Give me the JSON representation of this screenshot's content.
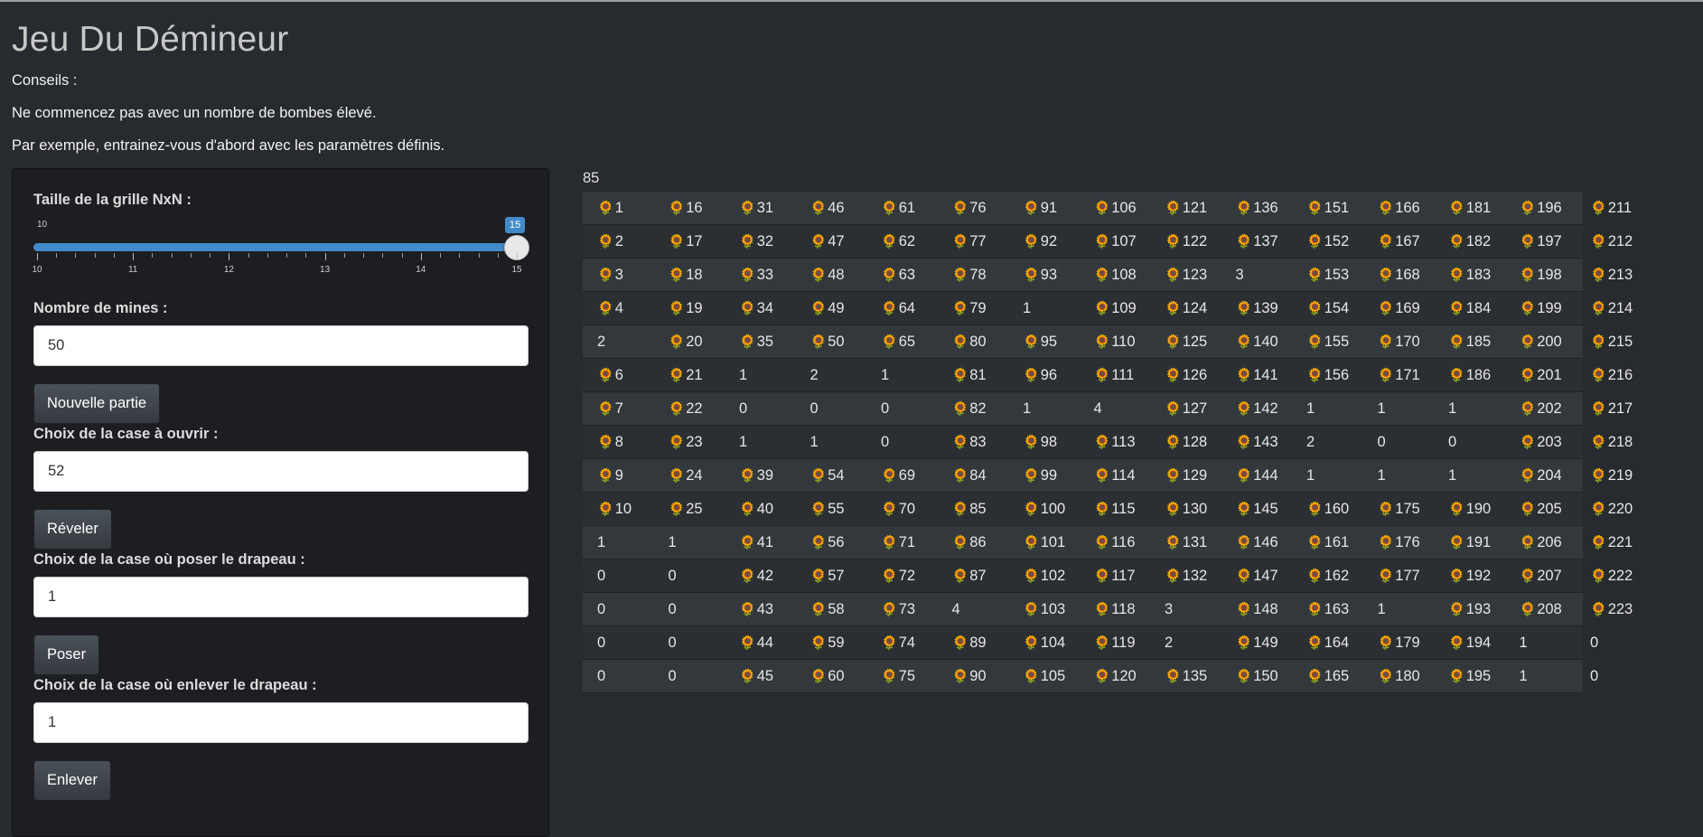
{
  "title": "Jeu Du Démineur",
  "tips": [
    "Conseils :",
    "Ne commencez pas avec un nombre de bombes élevé.",
    "Par exemple, entrainez-vous d'abord avec les paramètres définis."
  ],
  "controls": {
    "grid_size_label": "Taille de la grille NxN :",
    "slider": {
      "min": 10,
      "max": 15,
      "value": 15,
      "min_label": "10",
      "value_label": "15",
      "tick_labels": [
        "10",
        "11",
        "12",
        "13",
        "14",
        "15"
      ]
    },
    "mines_label": "Nombre de mines :",
    "mines_value": "50",
    "new_game_button": "Nouvelle partie",
    "open_label": "Choix de la case à ouvrir :",
    "open_value": "52",
    "reveal_button": "Réveler",
    "flag_label": "Choix de la case où poser le drapeau :",
    "flag_value": "1",
    "place_button": "Poser",
    "unflag_label": "Choix de la case où enlever le drapeau :",
    "unflag_value": "1",
    "remove_button": "Enlever"
  },
  "board": {
    "count": "85",
    "flag_icon": "sunflower-icon",
    "flag_glyph": "🌻",
    "rows": [
      [
        {
          "f": 1,
          "t": "1"
        },
        {
          "f": 1,
          "t": "16"
        },
        {
          "f": 1,
          "t": "31"
        },
        {
          "f": 1,
          "t": "46"
        },
        {
          "f": 1,
          "t": "61"
        },
        {
          "f": 1,
          "t": "76"
        },
        {
          "f": 1,
          "t": "91"
        },
        {
          "f": 1,
          "t": "106"
        },
        {
          "f": 1,
          "t": "121"
        },
        {
          "f": 1,
          "t": "136"
        },
        {
          "f": 1,
          "t": "151"
        },
        {
          "f": 1,
          "t": "166"
        },
        {
          "f": 1,
          "t": "181"
        },
        {
          "f": 1,
          "t": "196"
        },
        {
          "f": 1,
          "t": "211"
        }
      ],
      [
        {
          "f": 1,
          "t": "2"
        },
        {
          "f": 1,
          "t": "17"
        },
        {
          "f": 1,
          "t": "32"
        },
        {
          "f": 1,
          "t": "47"
        },
        {
          "f": 1,
          "t": "62"
        },
        {
          "f": 1,
          "t": "77"
        },
        {
          "f": 1,
          "t": "92"
        },
        {
          "f": 1,
          "t": "107"
        },
        {
          "f": 1,
          "t": "122"
        },
        {
          "f": 1,
          "t": "137"
        },
        {
          "f": 1,
          "t": "152"
        },
        {
          "f": 1,
          "t": "167"
        },
        {
          "f": 1,
          "t": "182"
        },
        {
          "f": 1,
          "t": "197"
        },
        {
          "f": 1,
          "t": "212"
        }
      ],
      [
        {
          "f": 1,
          "t": "3"
        },
        {
          "f": 1,
          "t": "18"
        },
        {
          "f": 1,
          "t": "33"
        },
        {
          "f": 1,
          "t": "48"
        },
        {
          "f": 1,
          "t": "63"
        },
        {
          "f": 1,
          "t": "78"
        },
        {
          "f": 1,
          "t": "93"
        },
        {
          "f": 1,
          "t": "108"
        },
        {
          "f": 1,
          "t": "123"
        },
        {
          "f": 0,
          "t": "3"
        },
        {
          "f": 1,
          "t": "153"
        },
        {
          "f": 1,
          "t": "168"
        },
        {
          "f": 1,
          "t": "183"
        },
        {
          "f": 1,
          "t": "198"
        },
        {
          "f": 1,
          "t": "213"
        }
      ],
      [
        {
          "f": 1,
          "t": "4"
        },
        {
          "f": 1,
          "t": "19"
        },
        {
          "f": 1,
          "t": "34"
        },
        {
          "f": 1,
          "t": "49"
        },
        {
          "f": 1,
          "t": "64"
        },
        {
          "f": 1,
          "t": "79"
        },
        {
          "f": 0,
          "t": "1"
        },
        {
          "f": 1,
          "t": "109"
        },
        {
          "f": 1,
          "t": "124"
        },
        {
          "f": 1,
          "t": "139"
        },
        {
          "f": 1,
          "t": "154"
        },
        {
          "f": 1,
          "t": "169"
        },
        {
          "f": 1,
          "t": "184"
        },
        {
          "f": 1,
          "t": "199"
        },
        {
          "f": 1,
          "t": "214"
        }
      ],
      [
        {
          "f": 0,
          "t": "2"
        },
        {
          "f": 1,
          "t": "20"
        },
        {
          "f": 1,
          "t": "35"
        },
        {
          "f": 1,
          "t": "50"
        },
        {
          "f": 1,
          "t": "65"
        },
        {
          "f": 1,
          "t": "80"
        },
        {
          "f": 1,
          "t": "95"
        },
        {
          "f": 1,
          "t": "110"
        },
        {
          "f": 1,
          "t": "125"
        },
        {
          "f": 1,
          "t": "140"
        },
        {
          "f": 1,
          "t": "155"
        },
        {
          "f": 1,
          "t": "170"
        },
        {
          "f": 1,
          "t": "185"
        },
        {
          "f": 1,
          "t": "200"
        },
        {
          "f": 1,
          "t": "215"
        }
      ],
      [
        {
          "f": 1,
          "t": "6"
        },
        {
          "f": 1,
          "t": "21"
        },
        {
          "f": 0,
          "t": "1"
        },
        {
          "f": 0,
          "t": "2"
        },
        {
          "f": 0,
          "t": "1"
        },
        {
          "f": 1,
          "t": "81"
        },
        {
          "f": 1,
          "t": "96"
        },
        {
          "f": 1,
          "t": "111"
        },
        {
          "f": 1,
          "t": "126"
        },
        {
          "f": 1,
          "t": "141"
        },
        {
          "f": 1,
          "t": "156"
        },
        {
          "f": 1,
          "t": "171"
        },
        {
          "f": 1,
          "t": "186"
        },
        {
          "f": 1,
          "t": "201"
        },
        {
          "f": 1,
          "t": "216"
        }
      ],
      [
        {
          "f": 1,
          "t": "7"
        },
        {
          "f": 1,
          "t": "22"
        },
        {
          "f": 0,
          "t": "0"
        },
        {
          "f": 0,
          "t": "0"
        },
        {
          "f": 0,
          "t": "0"
        },
        {
          "f": 1,
          "t": "82"
        },
        {
          "f": 0,
          "t": "1"
        },
        {
          "f": 0,
          "t": "4"
        },
        {
          "f": 1,
          "t": "127"
        },
        {
          "f": 1,
          "t": "142"
        },
        {
          "f": 0,
          "t": "1"
        },
        {
          "f": 0,
          "t": "1"
        },
        {
          "f": 0,
          "t": "1"
        },
        {
          "f": 1,
          "t": "202"
        },
        {
          "f": 1,
          "t": "217"
        }
      ],
      [
        {
          "f": 1,
          "t": "8"
        },
        {
          "f": 1,
          "t": "23"
        },
        {
          "f": 0,
          "t": "1"
        },
        {
          "f": 0,
          "t": "1"
        },
        {
          "f": 0,
          "t": "0"
        },
        {
          "f": 1,
          "t": "83"
        },
        {
          "f": 1,
          "t": "98"
        },
        {
          "f": 1,
          "t": "113"
        },
        {
          "f": 1,
          "t": "128"
        },
        {
          "f": 1,
          "t": "143"
        },
        {
          "f": 0,
          "t": "2"
        },
        {
          "f": 0,
          "t": "0"
        },
        {
          "f": 0,
          "t": "0"
        },
        {
          "f": 1,
          "t": "203"
        },
        {
          "f": 1,
          "t": "218"
        }
      ],
      [
        {
          "f": 1,
          "t": "9"
        },
        {
          "f": 1,
          "t": "24"
        },
        {
          "f": 1,
          "t": "39"
        },
        {
          "f": 1,
          "t": "54"
        },
        {
          "f": 1,
          "t": "69"
        },
        {
          "f": 1,
          "t": "84"
        },
        {
          "f": 1,
          "t": "99"
        },
        {
          "f": 1,
          "t": "114"
        },
        {
          "f": 1,
          "t": "129"
        },
        {
          "f": 1,
          "t": "144"
        },
        {
          "f": 0,
          "t": "1"
        },
        {
          "f": 0,
          "t": "1"
        },
        {
          "f": 0,
          "t": "1"
        },
        {
          "f": 1,
          "t": "204"
        },
        {
          "f": 1,
          "t": "219"
        }
      ],
      [
        {
          "f": 1,
          "t": "10"
        },
        {
          "f": 1,
          "t": "25"
        },
        {
          "f": 1,
          "t": "40"
        },
        {
          "f": 1,
          "t": "55"
        },
        {
          "f": 1,
          "t": "70"
        },
        {
          "f": 1,
          "t": "85"
        },
        {
          "f": 1,
          "t": "100"
        },
        {
          "f": 1,
          "t": "115"
        },
        {
          "f": 1,
          "t": "130"
        },
        {
          "f": 1,
          "t": "145"
        },
        {
          "f": 1,
          "t": "160"
        },
        {
          "f": 1,
          "t": "175"
        },
        {
          "f": 1,
          "t": "190"
        },
        {
          "f": 1,
          "t": "205"
        },
        {
          "f": 1,
          "t": "220"
        }
      ],
      [
        {
          "f": 0,
          "t": "1"
        },
        {
          "f": 0,
          "t": "1"
        },
        {
          "f": 1,
          "t": "41"
        },
        {
          "f": 1,
          "t": "56"
        },
        {
          "f": 1,
          "t": "71"
        },
        {
          "f": 1,
          "t": "86"
        },
        {
          "f": 1,
          "t": "101"
        },
        {
          "f": 1,
          "t": "116"
        },
        {
          "f": 1,
          "t": "131"
        },
        {
          "f": 1,
          "t": "146"
        },
        {
          "f": 1,
          "t": "161"
        },
        {
          "f": 1,
          "t": "176"
        },
        {
          "f": 1,
          "t": "191"
        },
        {
          "f": 1,
          "t": "206"
        },
        {
          "f": 1,
          "t": "221"
        }
      ],
      [
        {
          "f": 0,
          "t": "0"
        },
        {
          "f": 0,
          "t": "0"
        },
        {
          "f": 1,
          "t": "42"
        },
        {
          "f": 1,
          "t": "57"
        },
        {
          "f": 1,
          "t": "72"
        },
        {
          "f": 1,
          "t": "87"
        },
        {
          "f": 1,
          "t": "102"
        },
        {
          "f": 1,
          "t": "117"
        },
        {
          "f": 1,
          "t": "132"
        },
        {
          "f": 1,
          "t": "147"
        },
        {
          "f": 1,
          "t": "162"
        },
        {
          "f": 1,
          "t": "177"
        },
        {
          "f": 1,
          "t": "192"
        },
        {
          "f": 1,
          "t": "207"
        },
        {
          "f": 1,
          "t": "222"
        }
      ],
      [
        {
          "f": 0,
          "t": "0"
        },
        {
          "f": 0,
          "t": "0"
        },
        {
          "f": 1,
          "t": "43"
        },
        {
          "f": 1,
          "t": "58"
        },
        {
          "f": 1,
          "t": "73"
        },
        {
          "f": 0,
          "t": "4"
        },
        {
          "f": 1,
          "t": "103"
        },
        {
          "f": 1,
          "t": "118"
        },
        {
          "f": 0,
          "t": "3"
        },
        {
          "f": 1,
          "t": "148"
        },
        {
          "f": 1,
          "t": "163"
        },
        {
          "f": 0,
          "t": "1"
        },
        {
          "f": 1,
          "t": "193"
        },
        {
          "f": 1,
          "t": "208"
        },
        {
          "f": 1,
          "t": "223"
        }
      ],
      [
        {
          "f": 0,
          "t": "0"
        },
        {
          "f": 0,
          "t": "0"
        },
        {
          "f": 1,
          "t": "44"
        },
        {
          "f": 1,
          "t": "59"
        },
        {
          "f": 1,
          "t": "74"
        },
        {
          "f": 1,
          "t": "89"
        },
        {
          "f": 1,
          "t": "104"
        },
        {
          "f": 1,
          "t": "119"
        },
        {
          "f": 0,
          "t": "2"
        },
        {
          "f": 1,
          "t": "149"
        },
        {
          "f": 1,
          "t": "164"
        },
        {
          "f": 1,
          "t": "179"
        },
        {
          "f": 1,
          "t": "194"
        },
        {
          "f": 0,
          "t": "1"
        },
        {
          "f": 0,
          "t": "0"
        }
      ],
      [
        {
          "f": 0,
          "t": "0"
        },
        {
          "f": 0,
          "t": "0"
        },
        {
          "f": 1,
          "t": "45"
        },
        {
          "f": 1,
          "t": "60"
        },
        {
          "f": 1,
          "t": "75"
        },
        {
          "f": 1,
          "t": "90"
        },
        {
          "f": 1,
          "t": "105"
        },
        {
          "f": 1,
          "t": "120"
        },
        {
          "f": 1,
          "t": "135"
        },
        {
          "f": 1,
          "t": "150"
        },
        {
          "f": 1,
          "t": "165"
        },
        {
          "f": 1,
          "t": "180"
        },
        {
          "f": 1,
          "t": "195"
        },
        {
          "f": 0,
          "t": "1"
        },
        {
          "f": 0,
          "t": "0"
        }
      ]
    ]
  }
}
